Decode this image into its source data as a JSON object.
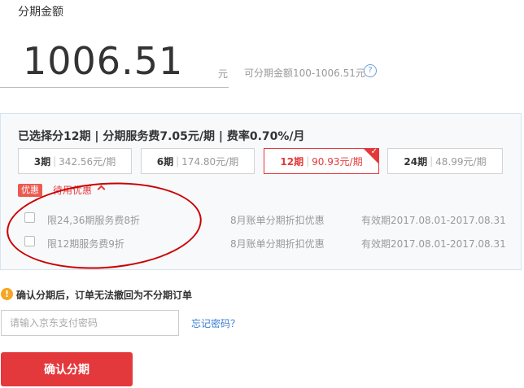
{
  "amount": {
    "label": "分期金额",
    "value": "1006.51",
    "unit": "元",
    "range_text": "可分期金额100-1006.51元",
    "help_glyph": "?"
  },
  "plan": {
    "summary": "已选择分12期 | 分期服务费7.05元/期 | 费率0.70%/月",
    "periods": [
      {
        "term": "3期",
        "fee": "342.56元/期",
        "selected": false
      },
      {
        "term": "6期",
        "fee": "174.80元/期",
        "selected": false
      },
      {
        "term": "12期",
        "fee": "90.93元/期",
        "selected": true
      },
      {
        "term": "24期",
        "fee": "48.99元/期",
        "selected": false
      }
    ],
    "separator": "|",
    "selected_check": "✓"
  },
  "discount": {
    "tag": "优惠",
    "toggle_label": "待用优惠",
    "coupons": [
      {
        "name": "限24,36期服务费8折",
        "desc": "8月账单分期折扣优惠",
        "validity": "有效期2017.08.01-2017.08.31",
        "checked": false
      },
      {
        "name": "限12期服务费9折",
        "desc": "8月账单分期折扣优惠",
        "validity": "有效期2017.08.01-2017.08.31",
        "checked": false
      }
    ]
  },
  "notice": {
    "icon_glyph": "!",
    "text": "确认分期后，订单无法撤回为不分期订单"
  },
  "password": {
    "placeholder": "请输入京东支付密码",
    "forgot_label": "忘记密码？"
  },
  "confirm": {
    "label": "确认分期"
  },
  "colors": {
    "accent": "#e4393c",
    "link": "#3a7bd5",
    "warning": "#f5a623",
    "annotation": "#cc0000"
  }
}
